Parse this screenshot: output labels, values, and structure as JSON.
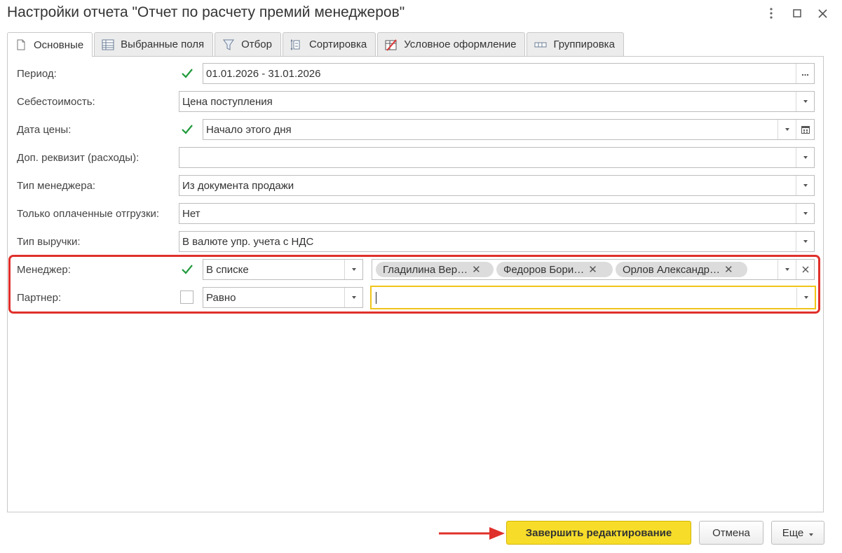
{
  "window": {
    "title": "Настройки отчета \"Отчет по расчету премий менеджеров\"",
    "menu_icon": "more-vertical-icon",
    "maximize_icon": "maximize-icon",
    "close_icon": "close-icon"
  },
  "tabs": [
    {
      "label": "Основные",
      "icon": "document-icon",
      "active": true
    },
    {
      "label": "Выбранные поля",
      "icon": "table-fields-icon",
      "active": false
    },
    {
      "label": "Отбор",
      "icon": "filter-icon",
      "active": false
    },
    {
      "label": "Сортировка",
      "icon": "sort-icon",
      "active": false
    },
    {
      "label": "Условное оформление",
      "icon": "conditional-format-icon",
      "active": false
    },
    {
      "label": "Группировка",
      "icon": "grouping-icon",
      "active": false
    }
  ],
  "fields": {
    "period": {
      "label": "Период:",
      "checked": true,
      "value": "01.01.2026 - 31.01.2026",
      "button": "..."
    },
    "cost": {
      "label": "Себестоимость:",
      "value": "Цена поступления"
    },
    "price_date": {
      "label": "Дата цены:",
      "checked": true,
      "value": "Начало этого дня"
    },
    "extra_attr": {
      "label": "Доп. реквизит (расходы):",
      "value": ""
    },
    "manager_type": {
      "label": "Тип менеджера:",
      "value": "Из документа продажи"
    },
    "paid_only": {
      "label": "Только оплаченные отгрузки:",
      "value": "Нет"
    },
    "revenue_type": {
      "label": "Тип выручки:",
      "value": "В валюте упр. учета с НДС"
    },
    "manager": {
      "label": "Менеджер:",
      "checked": true,
      "condition": "В списке",
      "chips": [
        "Гладилина Вер…",
        "Федоров Бори…",
        "Орлов Александр…"
      ]
    },
    "partner": {
      "label": "Партнер:",
      "checked": false,
      "condition": "Равно",
      "value": ""
    }
  },
  "buttons": {
    "finish": "Завершить редактирование",
    "cancel": "Отмена",
    "more": "Еще"
  },
  "colors": {
    "highlight": "#e0302b",
    "primary_button": "#f7dd2a",
    "check": "#1f9a3b",
    "focus_border": "#f0c419"
  }
}
